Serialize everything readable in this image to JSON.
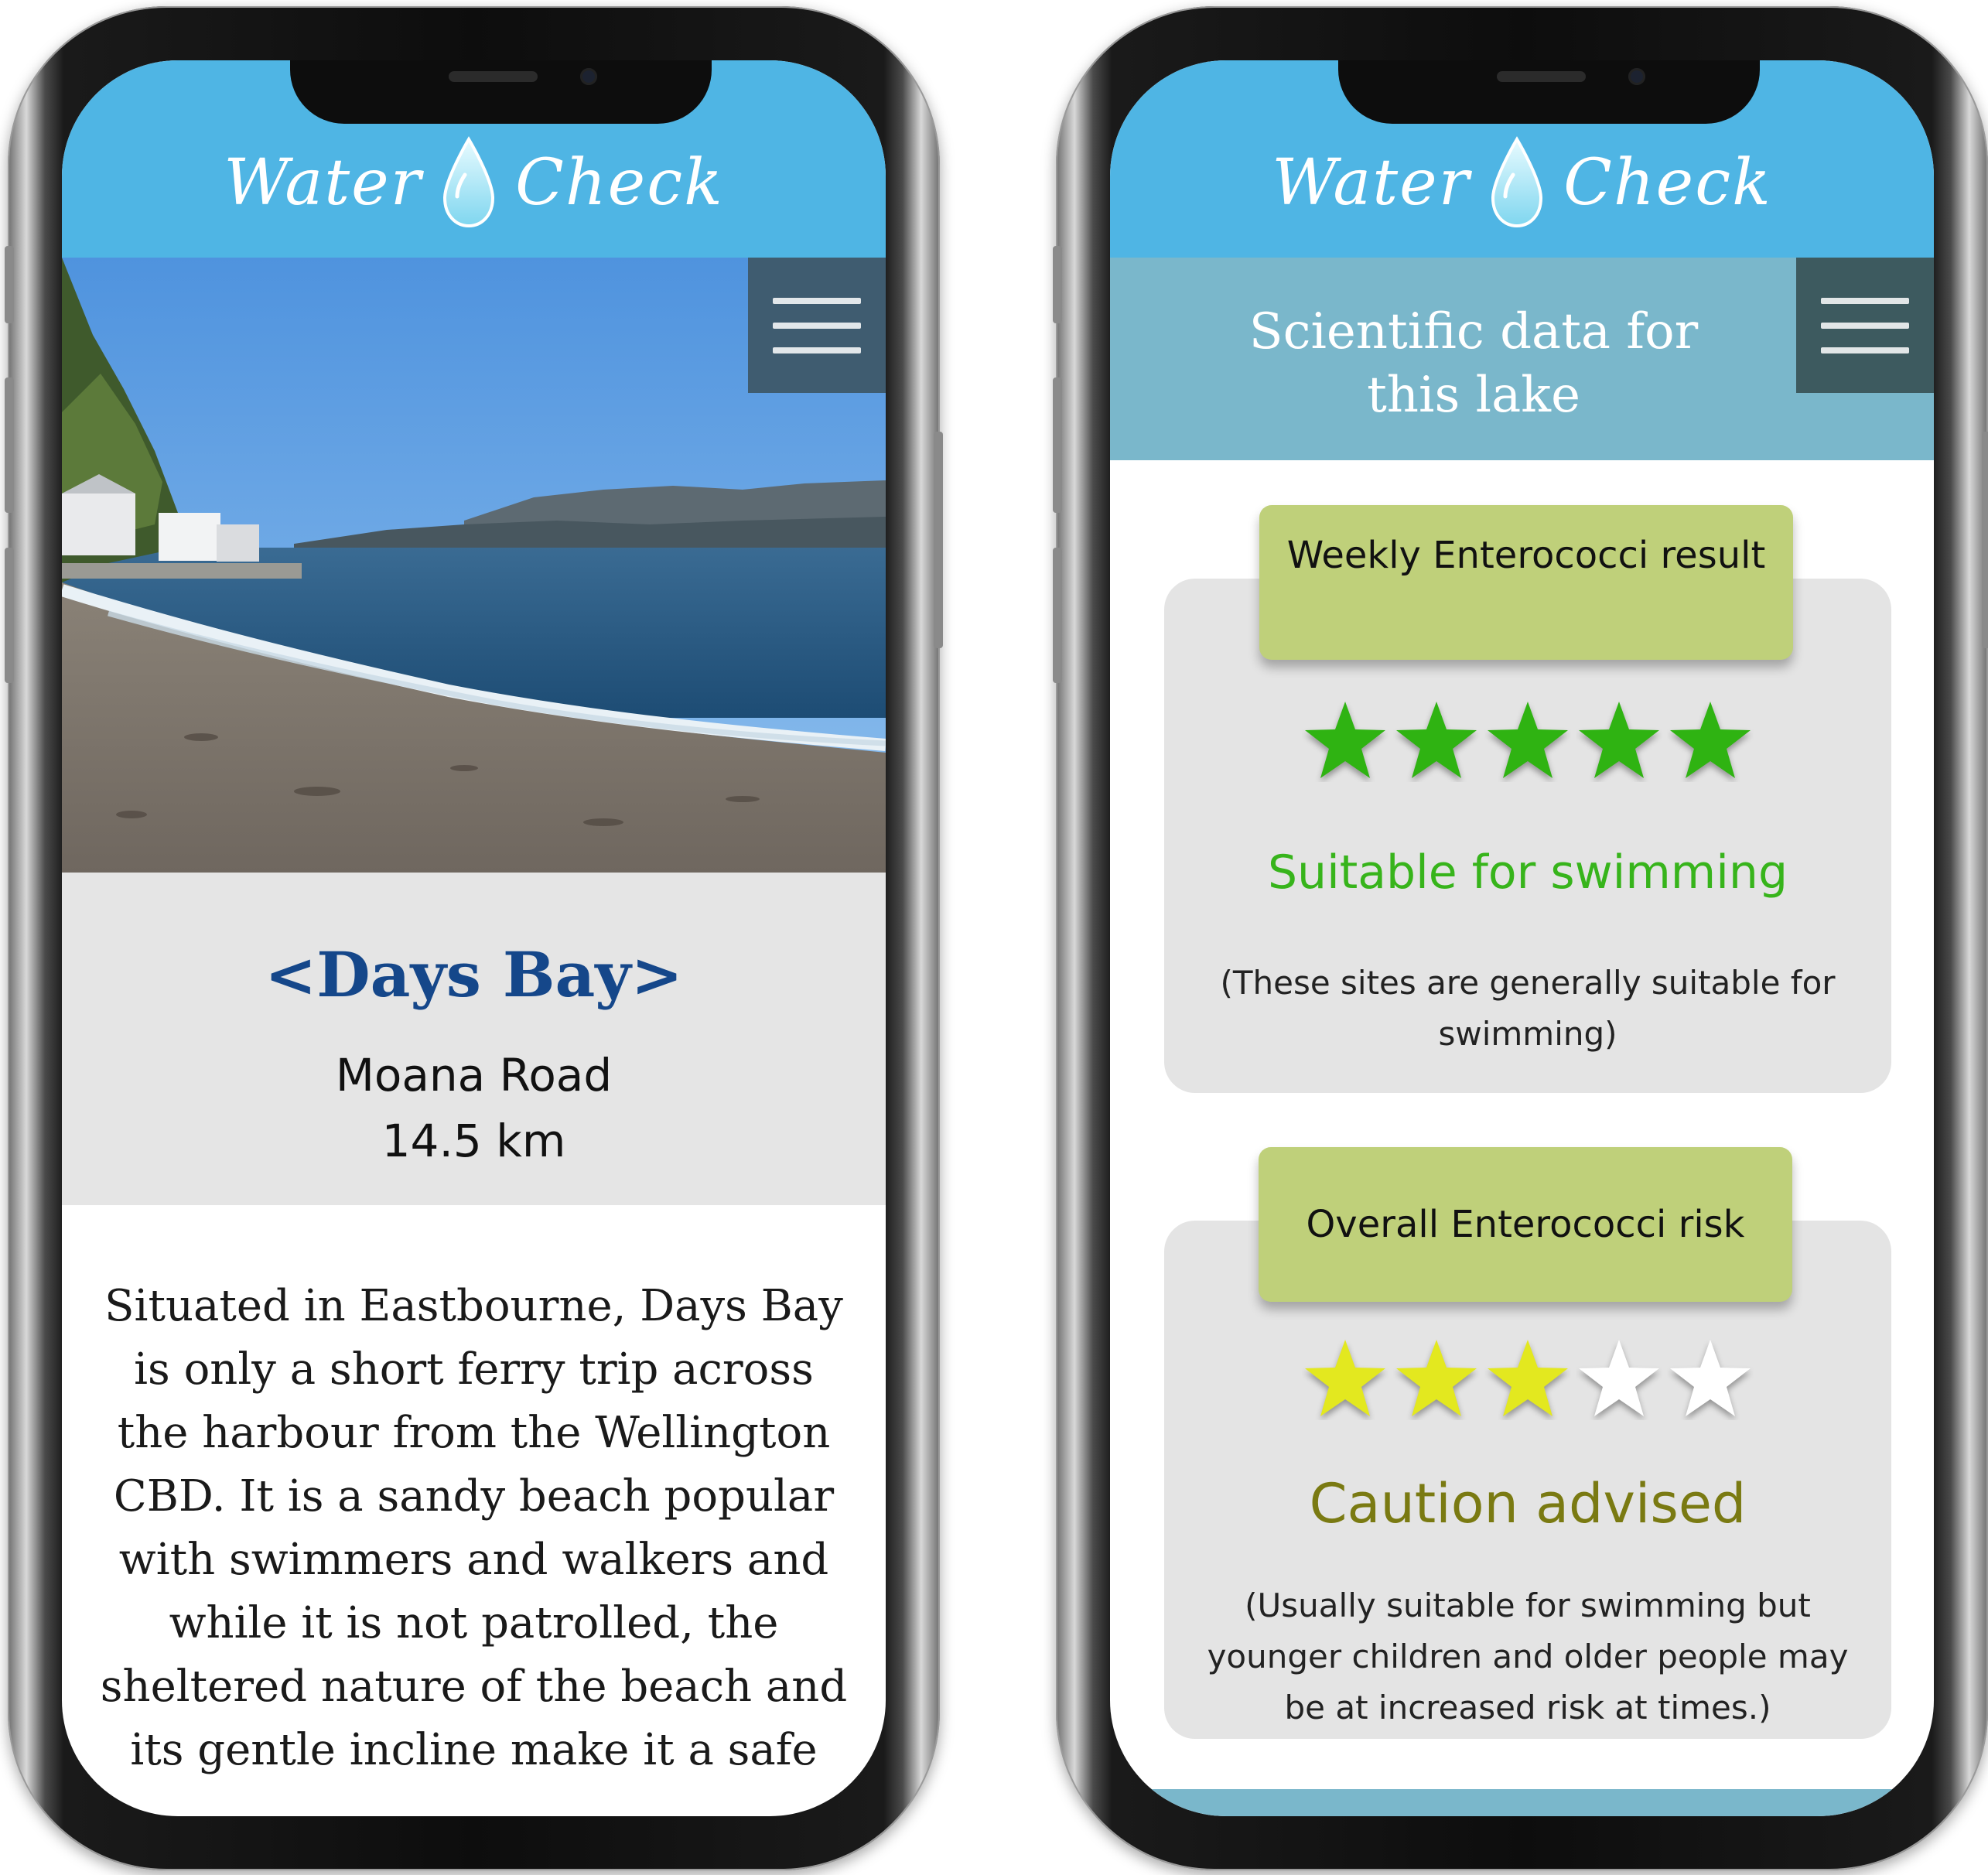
{
  "app": {
    "logo_left": "Water",
    "logo_right": "Check"
  },
  "left_screen": {
    "place_name": "<Days Bay>",
    "road": "Moana Road",
    "distance": "14.5 km",
    "description": "Situated in Eastbourne, Days Bay is only a short ferry trip across the harbour from the Wellington CBD. It is a sandy beach popular with swimmers and walkers and while it is not patrolled, the sheltered nature of the beach and its gentle incline make it a safe"
  },
  "right_screen": {
    "title": "Scientific data for this lake",
    "cards": [
      {
        "label": "Weekly Enterococci result",
        "rating": 5,
        "max_rating": 5,
        "star_color": "#2fb312",
        "verdict": "Suitable for swimming",
        "verdict_color": "#37b41b",
        "note": "(These sites are generally suitable for swimming)"
      },
      {
        "label": "Overall Enterococci risk",
        "rating": 3,
        "max_rating": 5,
        "star_color": "#e3e81f",
        "verdict": "Caution advised",
        "verdict_color": "#7a7a12",
        "note": "(Usually suitable for swimming but younger children and older people may be at increased risk at times.)"
      }
    ]
  },
  "colors": {
    "header_blue": "#4fb5e4",
    "menu_button": "#3f5c70",
    "banner": "#7ab7cb",
    "card_tab": "#bfd07a",
    "card_bg": "#e4e4e4",
    "place_title": "#15478a"
  },
  "icons": {
    "menu": "hamburger-icon",
    "logo": "water-drop-icon",
    "rating": "star-icon"
  }
}
